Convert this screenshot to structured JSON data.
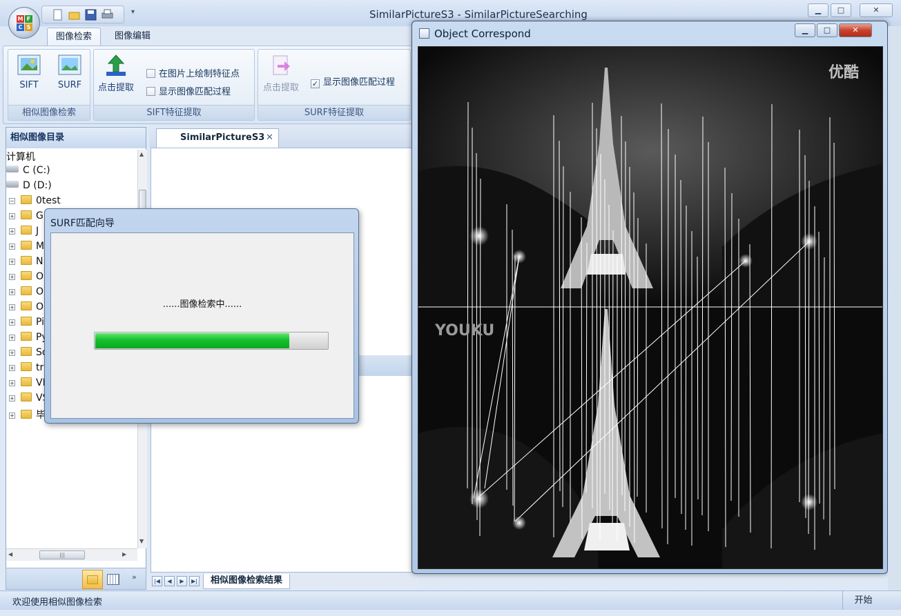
{
  "app": {
    "title": "SimilarPictureS3 - SimilarPictureSearching"
  },
  "ribbon": {
    "tabs": [
      "图像检索",
      "图像编辑"
    ],
    "groups": {
      "search": {
        "label": "相似图像检索",
        "buttons": [
          "SIFT",
          "SURF"
        ]
      },
      "sift": {
        "label": "SIFT特征提取",
        "button": "点击提取",
        "options": [
          {
            "label": "在图片上绘制特征点",
            "checked": false
          },
          {
            "label": "显示图像匹配过程",
            "checked": false
          }
        ]
      },
      "surf": {
        "label": "SURF特征提取",
        "button": "点击提取",
        "options": [
          {
            "label": "显示图像匹配过程",
            "checked": true
          }
        ]
      }
    }
  },
  "left_panel": {
    "title": "相似图像目录",
    "tree": [
      {
        "label": "计算机",
        "type": "root"
      },
      {
        "label": "C (C:)",
        "type": "drive"
      },
      {
        "label": "D (D:)",
        "type": "drive"
      },
      {
        "label": "0test",
        "type": "folder"
      },
      {
        "label": "G",
        "type": "folder"
      },
      {
        "label": "J",
        "type": "folder"
      },
      {
        "label": "M",
        "type": "folder"
      },
      {
        "label": "N",
        "type": "folder"
      },
      {
        "label": "O",
        "type": "folder"
      },
      {
        "label": "O",
        "type": "folder"
      },
      {
        "label": "Oracle",
        "type": "folder"
      },
      {
        "label": "Pictures",
        "type": "folder"
      },
      {
        "label": "Python",
        "type": "folder"
      },
      {
        "label": "Softwares",
        "type": "folder"
      },
      {
        "label": "traning_city",
        "type": "folder"
      },
      {
        "label": "VLfeat",
        "type": "folder"
      },
      {
        "label": "VS2010",
        "type": "folder"
      },
      {
        "label": "毕业设计",
        "type": "folder"
      }
    ]
  },
  "document": {
    "tab_label": "SimilarPictureS3",
    "bottom_tab": "相似图像检索结果"
  },
  "dialog": {
    "title": "SURF匹配向导",
    "message": "......图像检索中......",
    "progress": 0.83
  },
  "object_window": {
    "title": "Object Correspond",
    "watermark_top": "优酷",
    "watermark_mid": "YOUKU"
  },
  "status": {
    "text": "欢迎使用相似图像检索",
    "start_button": "开始"
  },
  "colors": {
    "progress": "#13c02d",
    "accent": "#c9432d"
  }
}
